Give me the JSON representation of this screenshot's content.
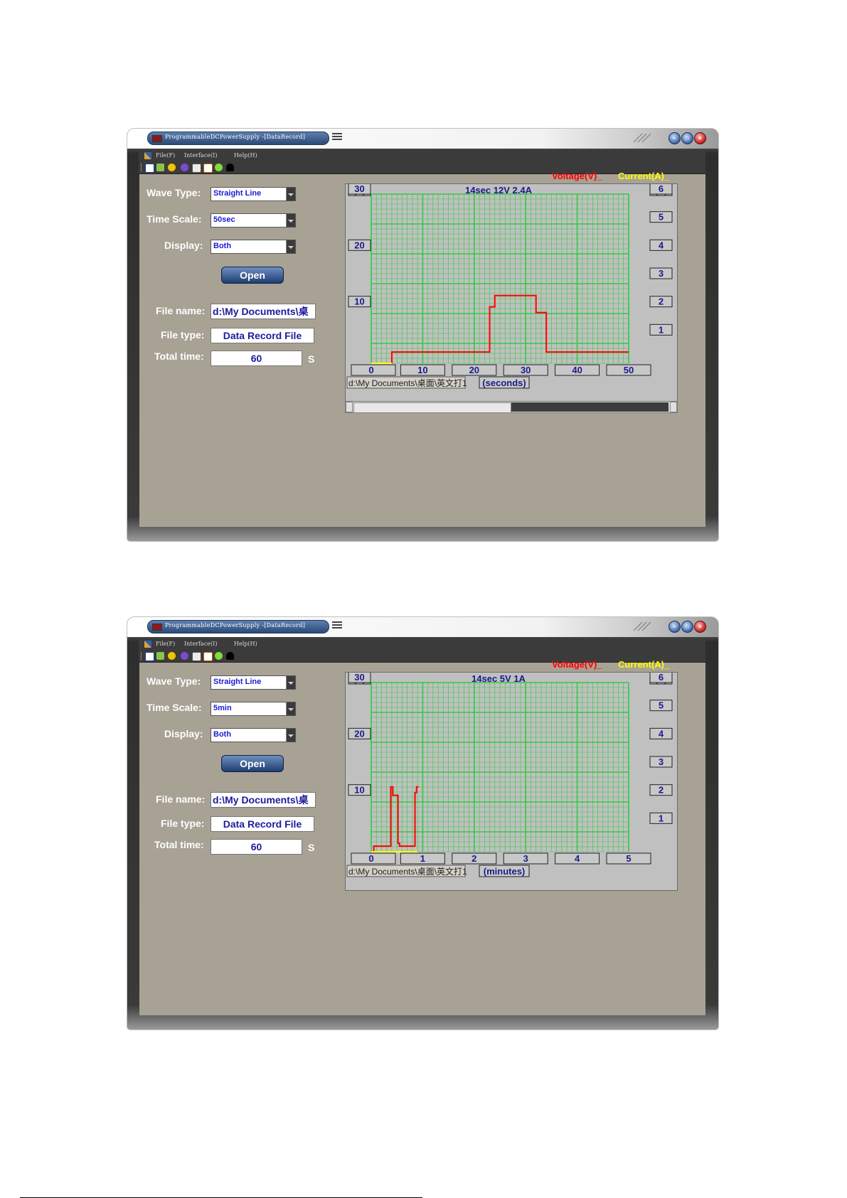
{
  "windows": [
    {
      "title": "ProgrammableDCPowerSupply -[DataRecord]",
      "menu": [
        "File(F)",
        "Interface(I)",
        "Help(H)"
      ],
      "legend": {
        "voltage": "Voltage(V)_",
        "current": "Current(A)_",
        "voltage_color": "#ff0000",
        "current_color": "#ffff00"
      },
      "form": {
        "wave_type_label": "Wave Type:",
        "wave_type_value": "Straight Line",
        "time_scale_label": "Time Scale:",
        "time_scale_value": "50sec",
        "display_label": "Display:",
        "display_value": "Both",
        "open_button": "Open",
        "file_name_label": "File name:",
        "file_name_value": "d:\\My Documents\\桌",
        "file_type_label": "File type:",
        "file_type_value": "Data Record File",
        "total_time_label": "Total time:",
        "total_time_value": "60",
        "total_time_unit": "S"
      },
      "chart": {
        "v_unit": "(V)",
        "a_unit": "(A)",
        "status": "14sec  12V  2.4A",
        "path_label": "d:\\My Documents\\桌面\\英文打1",
        "x_unit": "(seconds)",
        "has_scrollbar": true
      }
    },
    {
      "title": "ProgrammableDCPowerSupply -[DataRecord]",
      "menu": [
        "File(F)",
        "Interface(I)",
        "Help(H)"
      ],
      "legend": {
        "voltage": "Voltage(V)_",
        "current": "Current(A)_",
        "voltage_color": "#ff0000",
        "current_color": "#ffff00"
      },
      "form": {
        "wave_type_label": "Wave Type:",
        "wave_type_value": "Straight Line",
        "time_scale_label": "Time Scale:",
        "time_scale_value": "5min",
        "display_label": "Display:",
        "display_value": "Both",
        "open_button": "Open",
        "file_name_label": "File name:",
        "file_name_value": "d:\\My Documents\\桌",
        "file_type_label": "File type:",
        "file_type_value": "Data Record File",
        "total_time_label": "Total time:",
        "total_time_value": "60",
        "total_time_unit": "S"
      },
      "chart": {
        "v_unit": "(V)",
        "a_unit": "(A)",
        "status": "14sec  5V  1A",
        "path_label": "d:\\My Documents\\桌面\\英文打1",
        "x_unit": "(minutes)",
        "has_scrollbar": false
      }
    }
  ],
  "chart_data": [
    {
      "type": "line",
      "title": "14sec  12V  2.4A",
      "xlabel": "(seconds)",
      "ylabel": "(V)",
      "y2label": "(A)",
      "xlim": [
        0,
        50
      ],
      "ylim": [
        0,
        30
      ],
      "y2lim": [
        0,
        6
      ],
      "x_ticks": [
        0,
        10,
        20,
        30,
        40,
        50
      ],
      "y_ticks": [
        10,
        20,
        30
      ],
      "y2_ticks": [
        1,
        2,
        3,
        4,
        5,
        6
      ],
      "grid": true,
      "legend_position": "top-right",
      "series": [
        {
          "name": "Voltage(V)_",
          "color": "#ff0000",
          "x": [
            4,
            4,
            23,
            23,
            24,
            24,
            32,
            32,
            34,
            34,
            50
          ],
          "y": [
            0,
            2,
            2,
            10,
            10,
            12,
            12,
            9,
            9,
            2,
            2
          ]
        },
        {
          "name": "Current(A)_",
          "color": "#ffff00",
          "x": [
            0,
            4
          ],
          "y": [
            0,
            0
          ]
        }
      ]
    },
    {
      "type": "line",
      "title": "14sec  5V  1A",
      "xlabel": "(minutes)",
      "ylabel": "(V)",
      "y2label": "(A)",
      "xlim": [
        0,
        5
      ],
      "ylim": [
        0,
        30
      ],
      "y2lim": [
        0,
        6
      ],
      "x_ticks": [
        0,
        1,
        2,
        3,
        4,
        5
      ],
      "y_ticks": [
        10,
        20,
        30
      ],
      "y2_ticks": [
        1,
        2,
        3,
        4,
        5,
        6
      ],
      "grid": true,
      "legend_position": "top-right",
      "series": [
        {
          "name": "Voltage(V)_",
          "color": "#ff0000",
          "x": [
            0.05,
            0.05,
            0.38,
            0.38,
            0.42,
            0.42,
            0.52,
            0.52,
            0.55,
            0.55,
            0.85,
            0.85,
            0.88,
            0.88,
            0.92
          ],
          "y": [
            0,
            1,
            1,
            11.5,
            11.5,
            10,
            10,
            1.5,
            1.5,
            1,
            1,
            10.5,
            10.5,
            11.5,
            11.5
          ]
        },
        {
          "name": "Current(A)_",
          "color": "#ffff00",
          "x": [
            0,
            0.9
          ],
          "y": [
            0,
            0
          ]
        }
      ]
    }
  ]
}
